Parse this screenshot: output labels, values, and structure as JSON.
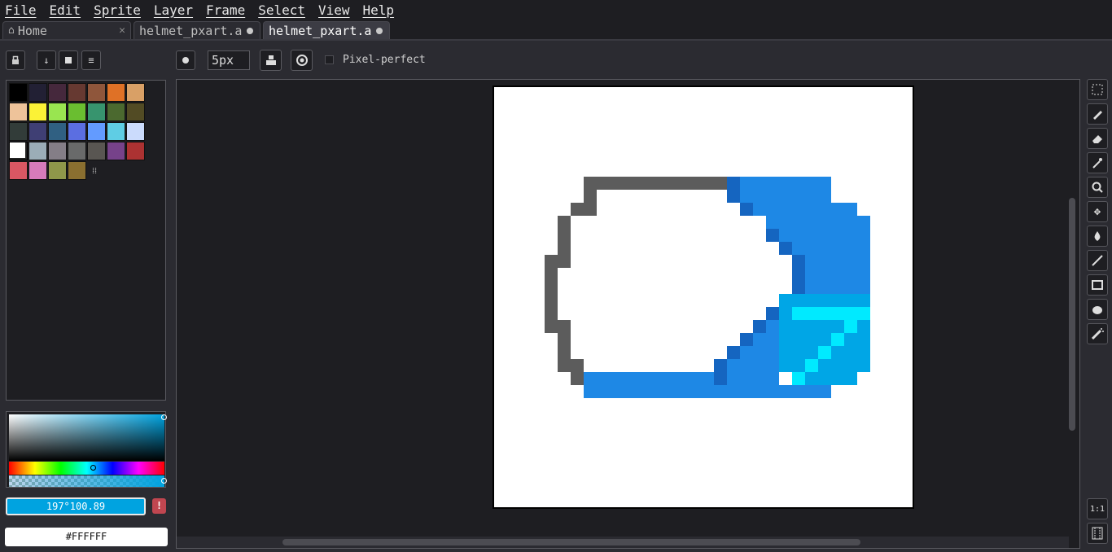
{
  "menu": [
    "File",
    "Edit",
    "Sprite",
    "Layer",
    "Frame",
    "Select",
    "View",
    "Help"
  ],
  "tabs": [
    {
      "label": "Home",
      "icon": "home-icon",
      "close": "✕"
    },
    {
      "label": "helmet_pxart.a",
      "modified": true
    },
    {
      "label": "helmet_pxart.a",
      "modified": true,
      "active": true
    }
  ],
  "toolbar": {
    "brush_size": "5px",
    "pixel_perfect_label": "Pixel-perfect",
    "pixel_perfect_checked": false
  },
  "palette": {
    "colors": [
      "#000000",
      "#222034",
      "#45283c",
      "#663931",
      "#8f563b",
      "#df7126",
      "#d9a066",
      "#eec39a",
      "#fbf236",
      "#99e550",
      "#6abe30",
      "#37946e",
      "#4b692f",
      "#524b24",
      "#323c39",
      "#3f3f74",
      "#306082",
      "#5b6ee1",
      "#639bff",
      "#5fcde4",
      "#cbdbfc",
      "#ffffff",
      "#9badb7",
      "#847e87",
      "#696a6a",
      "#595652",
      "#76428a",
      "#ac3232",
      "#d95763",
      "#d77bba",
      "#8f974a",
      "#8a6f30"
    ],
    "selected_index": 21
  },
  "color": {
    "hsv_text": "197°100.89",
    "hex_text": "#FFFFFF",
    "warning_label": "!",
    "accent": "#00a3e0"
  },
  "sprite": {
    "outline": "#5c5c5c",
    "blue": "#1e88e5",
    "dark_blue": "#1565c0",
    "cyan": "#00a6e6",
    "bright": "#00eaff"
  },
  "tools": [
    "marquee-icon",
    "pencil-icon",
    "eraser-icon",
    "eyedropper-icon",
    "zoom-icon",
    "move-icon",
    "paint-bucket-icon",
    "line-icon",
    "rectangle-icon",
    "blob-icon",
    "spray-icon"
  ],
  "bottom_tools": {
    "zoom_label": "1:1"
  }
}
